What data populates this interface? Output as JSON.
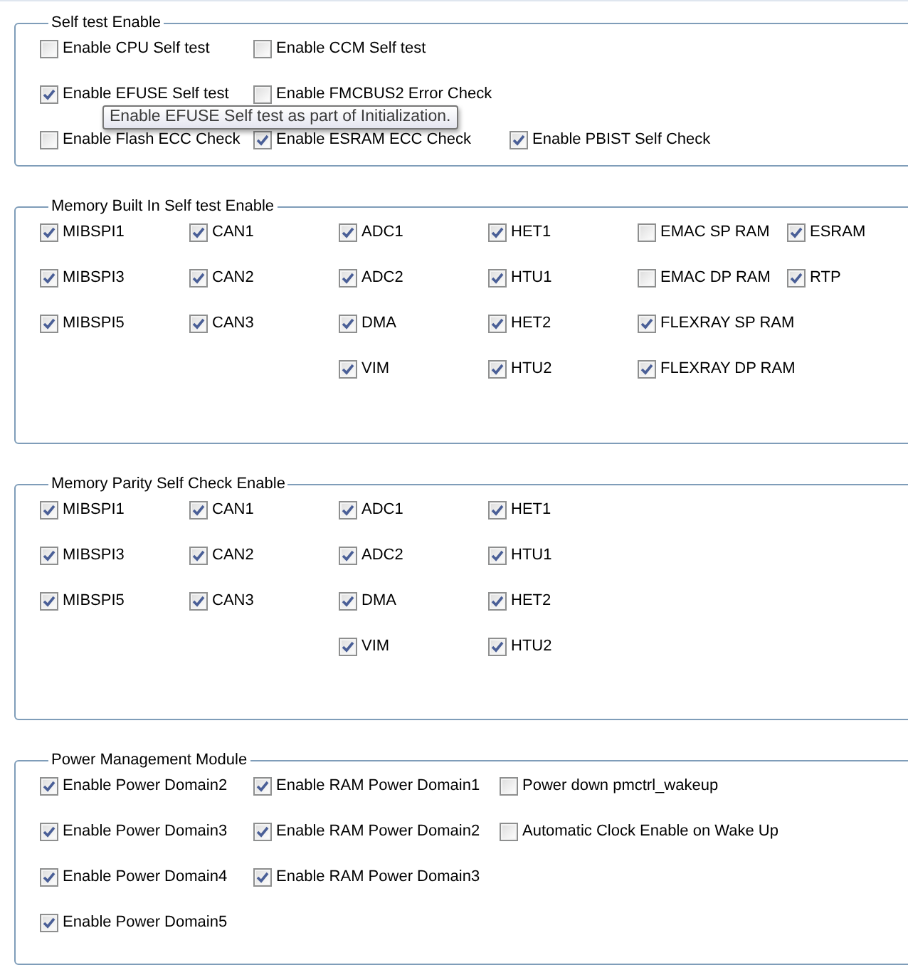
{
  "groups": [
    {
      "title": "Self test Enable",
      "columns": [
        [
          {
            "kind": "checkbox",
            "label": "Enable CPU Self test",
            "checked": false
          },
          {
            "kind": "checkbox",
            "label": "Enable EFUSE Self test",
            "checked": true
          },
          {
            "kind": "checkbox",
            "label": "Enable Flash ECC Check",
            "checked": false
          }
        ],
        [
          {
            "kind": "checkbox",
            "label": "Enable CCM Self test",
            "checked": false
          },
          {
            "kind": "checkbox",
            "label": "Enable FMCBUS2 Error Check",
            "checked": false
          },
          {
            "kind": "checkbox",
            "label": "Enable ESRAM ECC Check",
            "checked": true
          }
        ],
        [
          {
            "kind": "blank"
          },
          {
            "kind": "blank"
          },
          {
            "kind": "checkbox",
            "label": "Enable PBIST Self Check",
            "checked": true
          }
        ]
      ]
    },
    {
      "title": "Memory Built In Self test Enable",
      "columns": [
        [
          {
            "kind": "checkbox",
            "label": "MIBSPI1",
            "checked": true
          },
          {
            "kind": "checkbox",
            "label": "MIBSPI3",
            "checked": true
          },
          {
            "kind": "checkbox",
            "label": "MIBSPI5",
            "checked": true
          }
        ],
        [
          {
            "kind": "checkbox",
            "label": "CAN1",
            "checked": true
          },
          {
            "kind": "checkbox",
            "label": "CAN2",
            "checked": true
          },
          {
            "kind": "checkbox",
            "label": "CAN3",
            "checked": true
          }
        ],
        [
          {
            "kind": "checkbox",
            "label": "ADC1",
            "checked": true
          },
          {
            "kind": "checkbox",
            "label": "ADC2",
            "checked": true
          },
          {
            "kind": "checkbox",
            "label": "DMA",
            "checked": true
          },
          {
            "kind": "checkbox",
            "label": "VIM",
            "checked": true
          }
        ],
        [
          {
            "kind": "checkbox",
            "label": "HET1",
            "checked": true
          },
          {
            "kind": "checkbox",
            "label": "HTU1",
            "checked": true
          },
          {
            "kind": "checkbox",
            "label": "HET2",
            "checked": true
          },
          {
            "kind": "checkbox",
            "label": "HTU2",
            "checked": true
          }
        ],
        [
          {
            "kind": "checkbox",
            "label": "EMAC SP RAM",
            "checked": false
          },
          {
            "kind": "checkbox",
            "label": "EMAC DP RAM",
            "checked": false
          },
          {
            "kind": "checkbox",
            "label": "FLEXRAY SP RAM",
            "checked": true
          },
          {
            "kind": "checkbox",
            "label": "FLEXRAY DP RAM",
            "checked": true
          }
        ],
        [
          {
            "kind": "checkbox",
            "label": "ESRAM",
            "checked": true
          },
          {
            "kind": "checkbox",
            "label": "RTP",
            "checked": true
          }
        ]
      ]
    },
    {
      "title": "Memory Parity Self Check Enable",
      "columns": [
        [
          {
            "kind": "checkbox",
            "label": "MIBSPI1",
            "checked": true
          },
          {
            "kind": "checkbox",
            "label": "MIBSPI3",
            "checked": true
          },
          {
            "kind": "checkbox",
            "label": "MIBSPI5",
            "checked": true
          }
        ],
        [
          {
            "kind": "checkbox",
            "label": "CAN1",
            "checked": true
          },
          {
            "kind": "checkbox",
            "label": "CAN2",
            "checked": true
          },
          {
            "kind": "checkbox",
            "label": "CAN3",
            "checked": true
          }
        ],
        [
          {
            "kind": "checkbox",
            "label": "ADC1",
            "checked": true
          },
          {
            "kind": "checkbox",
            "label": "ADC2",
            "checked": true
          },
          {
            "kind": "checkbox",
            "label": "DMA",
            "checked": true
          },
          {
            "kind": "checkbox",
            "label": "VIM",
            "checked": true
          }
        ],
        [
          {
            "kind": "checkbox",
            "label": "HET1",
            "checked": true
          },
          {
            "kind": "checkbox",
            "label": "HTU1",
            "checked": true
          },
          {
            "kind": "checkbox",
            "label": "HET2",
            "checked": true
          },
          {
            "kind": "checkbox",
            "label": "HTU2",
            "checked": true
          }
        ]
      ]
    },
    {
      "title": "Power Management Module",
      "columns": [
        [
          {
            "kind": "checkbox",
            "label": "Enable Power Domain2",
            "checked": true
          },
          {
            "kind": "checkbox",
            "label": "Enable Power Domain3",
            "checked": true
          },
          {
            "kind": "checkbox",
            "label": "Enable Power Domain4",
            "checked": true
          },
          {
            "kind": "checkbox",
            "label": "Enable Power Domain5",
            "checked": true
          }
        ],
        [
          {
            "kind": "checkbox",
            "label": "Enable RAM Power Domain1",
            "checked": true
          },
          {
            "kind": "checkbox",
            "label": "Enable RAM Power Domain2",
            "checked": true
          },
          {
            "kind": "checkbox",
            "label": "Enable RAM Power Domain3",
            "checked": true
          }
        ],
        [
          {
            "kind": "checkbox",
            "label": "Power down pmctrl_wakeup",
            "checked": false
          },
          {
            "kind": "checkbox",
            "label": "Automatic Clock Enable on Wake Up",
            "checked": false
          }
        ]
      ]
    }
  ],
  "tooltip": {
    "text": "Enable EFUSE Self test as part of Initialization."
  }
}
